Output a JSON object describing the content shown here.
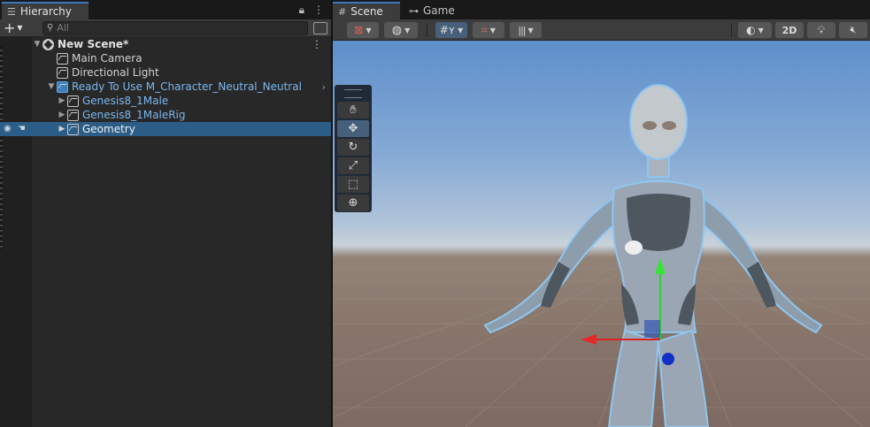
{
  "hierarchy": {
    "tab_label": "Hierarchy",
    "tab_icon": "list-icon",
    "add_label": "+",
    "search_placeholder": "All",
    "tree": {
      "scene": "New Scene*",
      "camera": "Main Camera",
      "light": "Directional Light",
      "prefab_root": "Ready To Use M_Character_Neutral_Neutral",
      "child1": "Genesis8_1Male",
      "child2": "Genesis8_1MaleRig",
      "child3": "Geometry"
    }
  },
  "scene_view": {
    "tabs": [
      {
        "label": "Scene",
        "icon": "grid-hash-icon"
      },
      {
        "label": "Game",
        "icon": "gamepad-icon"
      }
    ],
    "toolbar": {
      "mode_2d": "2D"
    },
    "tools": [
      "hand-tool",
      "move-tool",
      "rotate-tool",
      "scale-tool",
      "rect-tool",
      "transform-tool"
    ]
  },
  "colors": {
    "accent_selection": "#2c5d87",
    "prefab_text": "#7bb7f0",
    "sky_top": "#5e8fcb",
    "ground": "#857268"
  }
}
